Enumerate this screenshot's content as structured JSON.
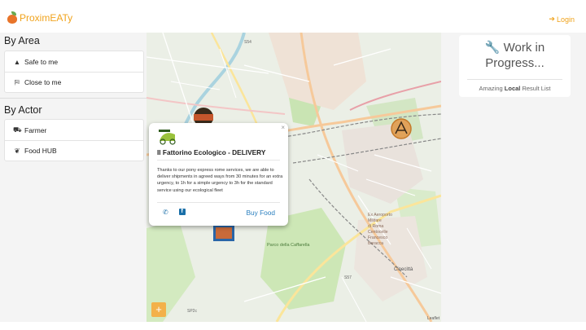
{
  "header": {
    "brand": "ProximEATy",
    "login_label": "Login"
  },
  "sidebar": {
    "area_title": "By Area",
    "area_items": [
      {
        "icon": "warning-icon",
        "label": "Safe to me"
      },
      {
        "icon": "map-icon",
        "label": "Close to me"
      }
    ],
    "actor_title": "By Actor",
    "actor_items": [
      {
        "icon": "tractor-icon",
        "label": "Farmer"
      },
      {
        "icon": "leaf-icon",
        "label": "Food HUB"
      }
    ]
  },
  "map": {
    "labels": {
      "road_s54": "S54",
      "road_s57": "S57",
      "road_sp2c": "SP2c",
      "parco": "Parco della Caffarella",
      "cinecitta": "Cinecittà",
      "attribution": "Leaflet"
    },
    "zoom_label": "+"
  },
  "popup": {
    "title": "Il Fattorino Ecologico - DELIVERY",
    "description": "Thanks to our pony express rome services, we are able to deliver shipments in agreed ways from 30 minutes for an extra urgency, to 1h for a simple urgency to 3h for the standard service using our ecological fleet",
    "buy_label": "Buy Food",
    "close_label": "×"
  },
  "results": {
    "title": "Work in Progress...",
    "subtitle_pre": "Amazing ",
    "subtitle_bold": "Local",
    "subtitle_post": " Result List"
  },
  "colors": {
    "accent": "#f0a31c",
    "link": "#2a7fbf"
  }
}
